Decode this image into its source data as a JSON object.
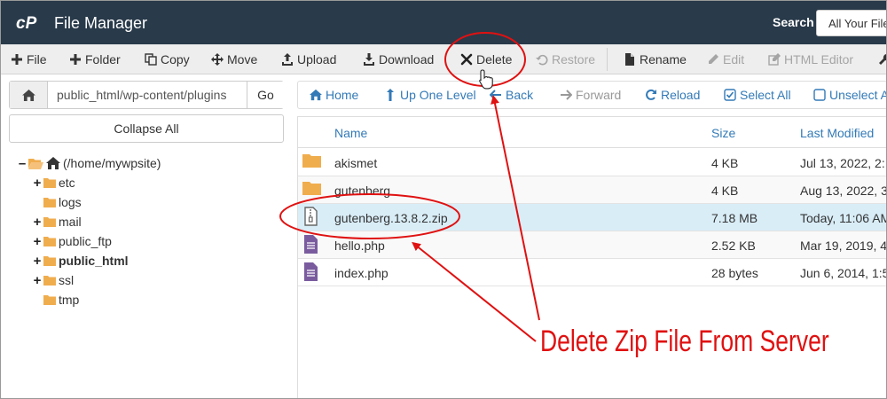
{
  "header": {
    "app_title": "File Manager",
    "logo_icon": "cpanel-logo-icon",
    "search_label": "Search",
    "search_scope": "All Your Files"
  },
  "toolbar": {
    "items": [
      {
        "label": "File",
        "icon": "plus-icon",
        "disabled": false
      },
      {
        "label": "Folder",
        "icon": "plus-icon",
        "disabled": false
      },
      {
        "label": "Copy",
        "icon": "copy-icon",
        "disabled": false
      },
      {
        "label": "Move",
        "icon": "move-icon",
        "disabled": false
      },
      {
        "label": "Upload",
        "icon": "upload-icon",
        "disabled": false
      },
      {
        "label": "Download",
        "icon": "download-icon",
        "disabled": false
      },
      {
        "label": "Delete",
        "icon": "close-icon",
        "disabled": false
      },
      {
        "label": "Restore",
        "icon": "restore-icon",
        "disabled": true
      },
      {
        "label": "Rename",
        "icon": "file-icon",
        "disabled": false
      },
      {
        "label": "Edit",
        "icon": "pencil-icon",
        "disabled": true
      },
      {
        "label": "HTML Editor",
        "icon": "edit-square-icon",
        "disabled": true
      }
    ]
  },
  "sidebar": {
    "path_value": "public_html/wp-content/plugins",
    "go_label": "Go",
    "collapse_label": "Collapse All",
    "tree": [
      {
        "label": "(/home/mywpsite)",
        "toggle": "–"
      },
      {
        "label": "etc",
        "toggle": "+"
      },
      {
        "label": "logs",
        "toggle": ""
      },
      {
        "label": "mail",
        "toggle": "+"
      },
      {
        "label": "public_ftp",
        "toggle": "+"
      },
      {
        "label": "public_html",
        "toggle": "+"
      },
      {
        "label": "ssl",
        "toggle": "+"
      },
      {
        "label": "tmp",
        "toggle": ""
      }
    ]
  },
  "nav": {
    "home": "Home",
    "up_one_level": "Up One Level",
    "back": "Back",
    "forward": "Forward",
    "reload": "Reload",
    "select_all": "Select All",
    "unselect_all": "Unselect All"
  },
  "table": {
    "columns": [
      "Name",
      "Size",
      "Last Modified"
    ],
    "rows": [
      {
        "name": "akismet",
        "size": "4 KB",
        "modified": "Jul 13, 2022, 2:",
        "type": "folder-icon"
      },
      {
        "name": "gutenberg",
        "size": "4 KB",
        "modified": "Aug 13, 2022, 3",
        "type": "folder-icon"
      },
      {
        "name": "gutenberg.13.8.2.zip",
        "size": "7.18 MB",
        "modified": "Today, 11:06 AM",
        "type": "zip-file-icon"
      },
      {
        "name": "hello.php",
        "size": "2.52 KB",
        "modified": "Mar 19, 2019, 4",
        "type": "php-file-icon"
      },
      {
        "name": "index.php",
        "size": "28 bytes",
        "modified": "Jun 6, 2014, 1:5",
        "type": "php-file-icon"
      }
    ]
  },
  "annotation": {
    "callout_text": "Delete Zip File From Server",
    "color": "#e01111"
  },
  "colors": {
    "header_bg": "#293a4a",
    "link": "#337ab7",
    "folder": "#f0ad4e",
    "selected_row": "#d9edf7"
  }
}
